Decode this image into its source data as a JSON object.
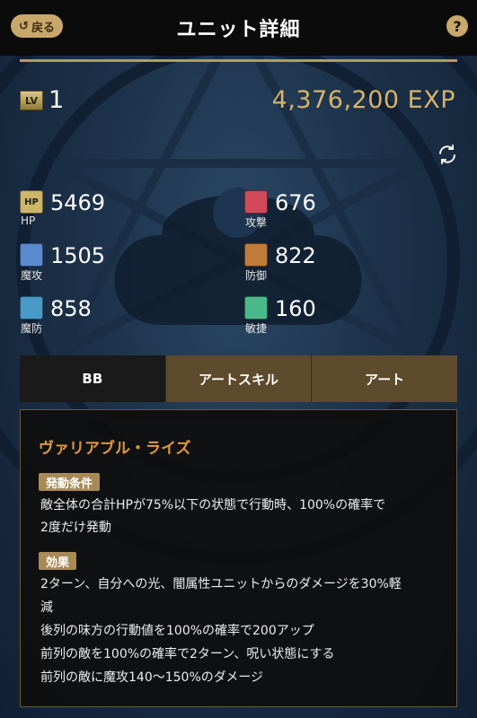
{
  "header": {
    "back_label": "戻る",
    "title": "ユニット詳細",
    "help_label": "?"
  },
  "level": {
    "badge": "LV",
    "value": "1"
  },
  "exp": "4,376,200 EXP",
  "stats": [
    {
      "key": "hp",
      "icon_text": "HP",
      "label": "HP",
      "value": "5469",
      "color": "#cdb66a",
      "icon": "hp-icon"
    },
    {
      "key": "attack",
      "icon_text": "",
      "label": "攻撃",
      "value": "676",
      "color": "#d04a5a",
      "icon": "sword-icon"
    },
    {
      "key": "magic-attack",
      "icon_text": "",
      "label": "魔攻",
      "value": "1505",
      "color": "#5a8ad0",
      "icon": "staff-icon"
    },
    {
      "key": "defense",
      "icon_text": "",
      "label": "防御",
      "value": "822",
      "color": "#c07a3a",
      "icon": "shield-icon"
    },
    {
      "key": "magic-defense",
      "icon_text": "",
      "label": "魔防",
      "value": "858",
      "color": "#4a9ac8",
      "icon": "magic-shield-icon"
    },
    {
      "key": "agility",
      "icon_text": "",
      "label": "敏捷",
      "value": "160",
      "color": "#4ab88a",
      "icon": "wing-icon"
    }
  ],
  "tabs": [
    "BB",
    "アートスキル",
    "アート"
  ],
  "skill": {
    "name": "ヴァリアブル・ライズ",
    "condition_tag": "発動条件",
    "condition_lines": [
      "敵全体の合計HPが75%以下の状態で行動時、100%の確率で",
      "2度だけ発動"
    ],
    "effect_tag": "効果",
    "effect_lines": [
      "2ターン、自分への光、闇属性ユニットからのダメージを30%軽",
      "減",
      "後列の味方の行動値を100%の確率で200アップ",
      "前列の敵を100%の確率で2ターン、呪い状態にする",
      "前列の敵に魔攻140〜150%のダメージ"
    ]
  }
}
